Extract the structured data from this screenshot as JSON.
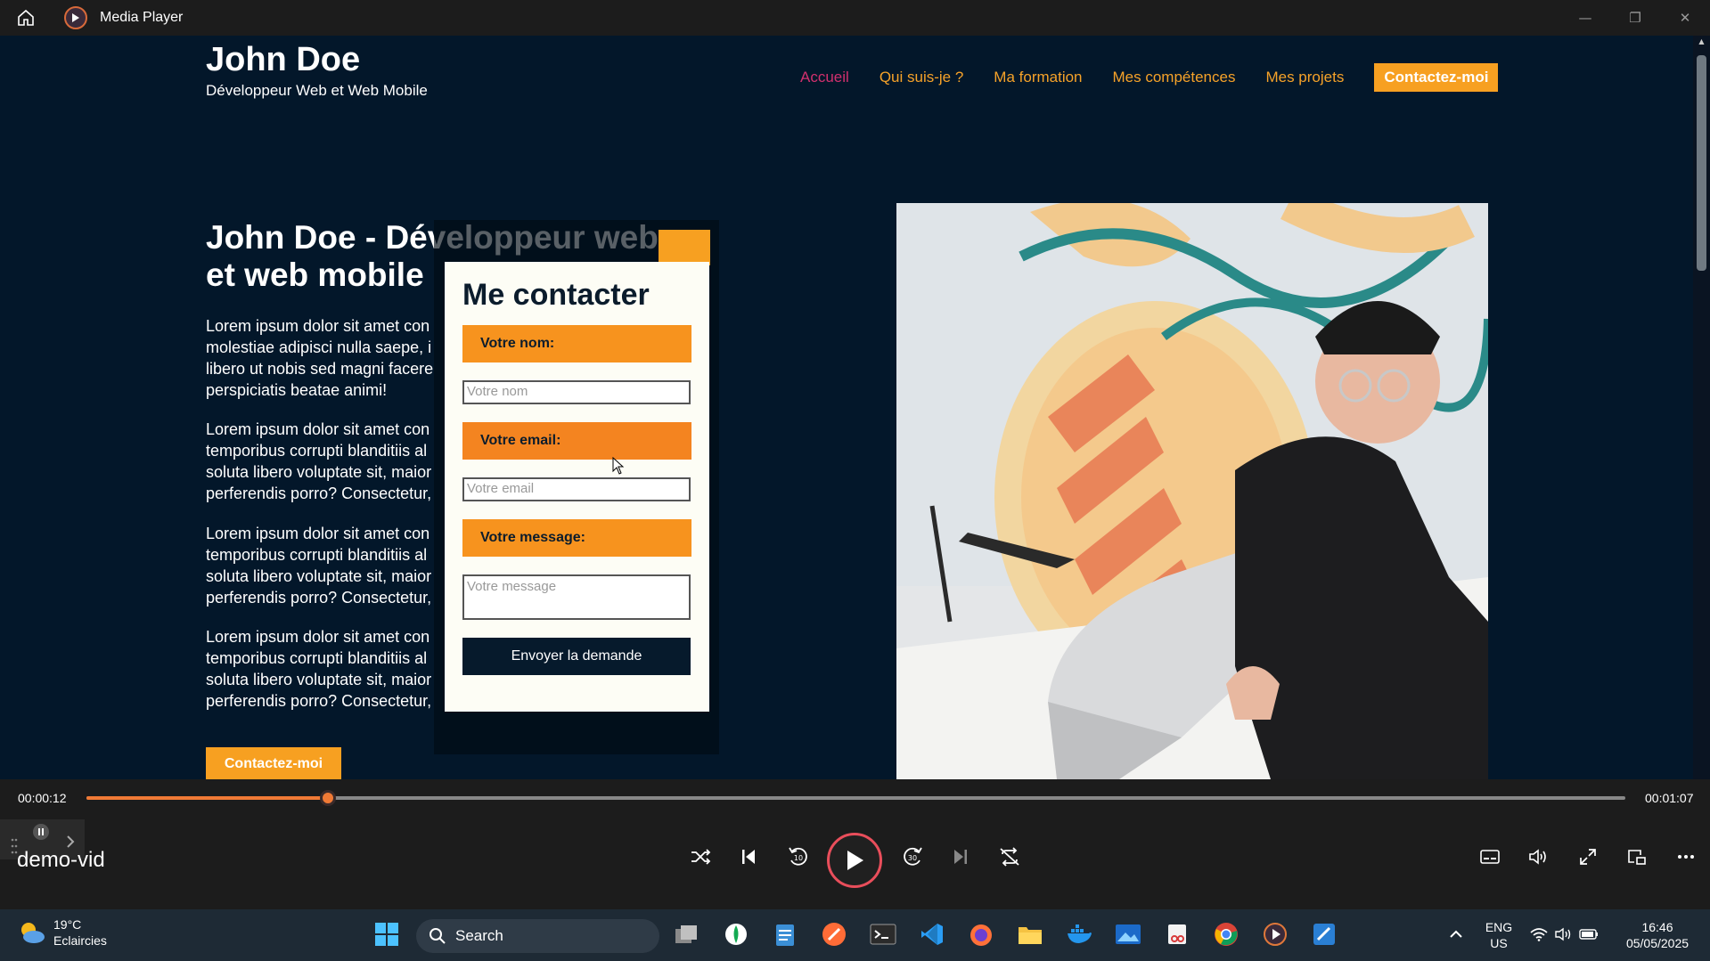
{
  "window": {
    "title": "Media Player"
  },
  "site": {
    "name": "John Doe",
    "subtitle": "Développeur Web et Web Mobile",
    "nav": [
      "Accueil",
      "Qui suis-je ?",
      "Ma formation",
      "Mes compétences",
      "Mes projets"
    ],
    "nav_cta": "Contactez-moi",
    "hero_title": "John Doe - Développeur web et web mobile",
    "paragraphs": [
      "Lorem ipsum dolor sit amet con\nmolestiae adipisci nulla saepe, i\nlibero ut nobis sed magni facere\nperspiciatis beatae animi!",
      "Lorem ipsum dolor sit amet con\ntemporibus corrupti blanditiis al\nsoluta libero voluptate sit, maior\nperferendis porro? Consectetur,",
      "Lorem ipsum dolor sit amet con\ntemporibus corrupti blanditiis al\nsoluta libero voluptate sit, maior\nperferendis porro? Consectetur,",
      "Lorem ipsum dolor sit amet con\ntemporibus corrupti blanditiis al\nsoluta libero voluptate sit, maior\nperferendis porro? Consectetur,"
    ],
    "hero_cta": "Contactez-moi"
  },
  "modal": {
    "title": "Me contacter",
    "name_label": "Votre nom:",
    "name_placeholder": "Votre nom",
    "email_label": "Votre email:",
    "email_placeholder": "Votre email",
    "message_label": "Votre message:",
    "message_placeholder": "Votre message",
    "submit": "Envoyer la demande"
  },
  "player": {
    "current_time": "00:00:12",
    "total_time": "00:01:07",
    "progress_percent": 15.7,
    "media_name": "demo-vid"
  },
  "taskbar": {
    "temp": "19°C",
    "weather": "Eclaircies",
    "search": "Search",
    "lang": "ENG",
    "region": "US",
    "time": "16:46",
    "date": "05/05/2025"
  },
  "colors": {
    "accent": "#f7a021",
    "nav_active": "#d2306e",
    "page_bg": "#03172a",
    "seek": "#f07a35"
  }
}
